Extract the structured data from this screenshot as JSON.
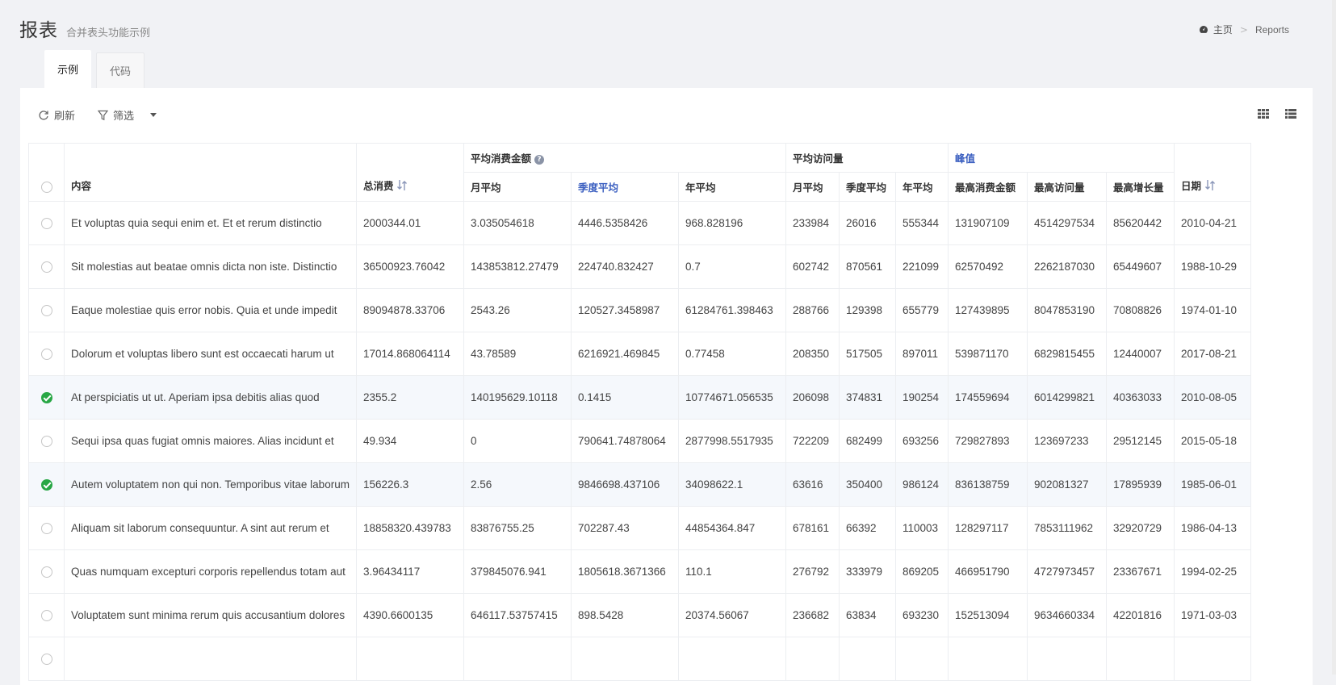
{
  "header": {
    "title": "报表",
    "subtitle": "合并表头功能示例"
  },
  "breadcrumb": {
    "home_label": "主页",
    "separator": ">",
    "current": "Reports"
  },
  "tabs": [
    {
      "label": "示例",
      "active": true
    },
    {
      "label": "代码",
      "active": false
    }
  ],
  "toolbar": {
    "refresh_label": "刷新",
    "filter_label": "筛选"
  },
  "colors": {
    "accent": "#3b5fc0",
    "checked": "#28a745",
    "selected_row": "#f5f8fc"
  },
  "table": {
    "group_headers": {
      "avg_spend": "平均消费金额",
      "avg_visits": "平均访问量",
      "peak": "峰值"
    },
    "columns": {
      "content": "内容",
      "total": "总消费",
      "monthly_spend": "月平均",
      "quarterly_spend": "季度平均",
      "yearly_spend": "年平均",
      "monthly_visits": "月平均",
      "quarterly_visits": "季度平均",
      "yearly_visits": "年平均",
      "max_spend": "最高消费金额",
      "max_visits": "最高访问量",
      "max_growth": "最高增长量",
      "date": "日期"
    },
    "rows": [
      {
        "checked": false,
        "cells": [
          "Et voluptas quia sequi enim et. Et et rerum distinctio",
          "2000344.01",
          "3.035054618",
          "4446.5358426",
          "968.828196",
          "233984",
          "26016",
          "555344",
          "131907109",
          "4514297534",
          "85620442",
          "2010-04-21"
        ]
      },
      {
        "checked": false,
        "cells": [
          "Sit molestias aut beatae omnis dicta non iste. Distinctio",
          "36500923.76042",
          "143853812.27479",
          "224740.832427",
          "0.7",
          "602742",
          "870561",
          "221099",
          "62570492",
          "2262187030",
          "65449607",
          "1988-10-29"
        ]
      },
      {
        "checked": false,
        "cells": [
          "Eaque molestiae quis error nobis. Quia et unde impedit",
          "89094878.33706",
          "2543.26",
          "120527.3458987",
          "61284761.398463",
          "288766",
          "129398",
          "655779",
          "127439895",
          "8047853190",
          "70808826",
          "1974-01-10"
        ]
      },
      {
        "checked": false,
        "cells": [
          "Dolorum et voluptas libero sunt est occaecati harum ut",
          "17014.868064114",
          "43.78589",
          "6216921.469845",
          "0.77458",
          "208350",
          "517505",
          "897011",
          "539871170",
          "6829815455",
          "12440007",
          "2017-08-21"
        ]
      },
      {
        "checked": true,
        "cells": [
          "At perspiciatis ut ut. Aperiam ipsa debitis alias quod",
          "2355.2",
          "140195629.10118",
          "0.1415",
          "10774671.056535",
          "206098",
          "374831",
          "190254",
          "174559694",
          "6014299821",
          "40363033",
          "2010-08-05"
        ]
      },
      {
        "checked": false,
        "cells": [
          "Sequi ipsa quas fugiat omnis maiores. Alias incidunt et",
          "49.934",
          "0",
          "790641.74878064",
          "2877998.5517935",
          "722209",
          "682499",
          "693256",
          "729827893",
          "123697233",
          "29512145",
          "2015-05-18"
        ]
      },
      {
        "checked": true,
        "cells": [
          "Autem voluptatem non qui non. Temporibus vitae laborum",
          "156226.3",
          "2.56",
          "9846698.437106",
          "34098622.1",
          "63616",
          "350400",
          "986124",
          "836138759",
          "902081327",
          "17895939",
          "1985-06-01"
        ]
      },
      {
        "checked": false,
        "cells": [
          "Aliquam sit laborum consequuntur. A sint aut rerum et",
          "18858320.439783",
          "83876755.25",
          "702287.43",
          "44854364.847",
          "678161",
          "66392",
          "110003",
          "128297117",
          "7853111962",
          "32920729",
          "1986-04-13"
        ]
      },
      {
        "checked": false,
        "cells": [
          "Quas numquam excepturi corporis repellendus totam aut",
          "3.96434117",
          "379845076.941",
          "1805618.3671366",
          "110.1",
          "276792",
          "333979",
          "869205",
          "466951790",
          "4727973457",
          "23367671",
          "1994-02-25"
        ]
      },
      {
        "checked": false,
        "cells": [
          "Voluptatem sunt minima rerum quis accusantium dolores",
          "4390.6600135",
          "646117.53757415",
          "898.5428",
          "20374.56067",
          "236682",
          "63834",
          "693230",
          "152513094",
          "9634660334",
          "42201816",
          "1971-03-03"
        ]
      },
      {
        "checked": false,
        "cells": [
          "",
          "",
          "",
          "",
          "",
          "",
          "",
          "",
          "",
          "",
          "",
          ""
        ]
      }
    ]
  }
}
